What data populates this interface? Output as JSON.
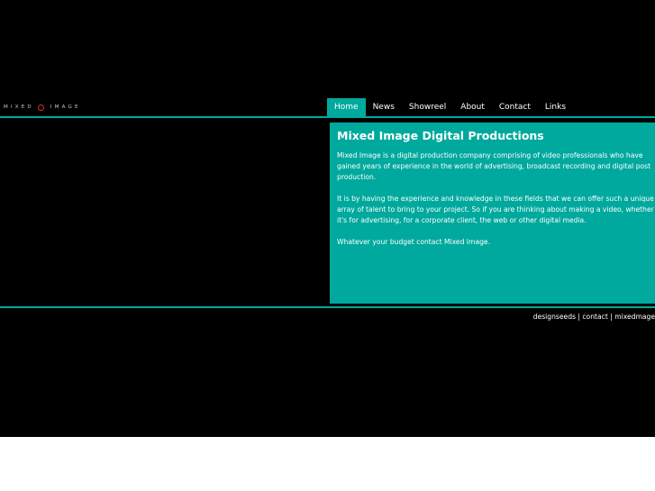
{
  "logo": {
    "left_text": "MIXED",
    "right_text": "IMAGE"
  },
  "nav": {
    "items": [
      {
        "label": "Home",
        "active": true
      },
      {
        "label": "News"
      },
      {
        "label": "Showreel"
      },
      {
        "label": "About"
      },
      {
        "label": "Contact"
      },
      {
        "label": "Links"
      }
    ]
  },
  "content": {
    "title": "Mixed Image Digital Productions",
    "paragraphs": [
      "Mixed Image is a digital production company comprising of video professionals who have gained years of experience in the world of advertising, broadcast recording and digital post production.",
      "It is by having the experience and knowledge in these fields that we can offer such a unique array of talent to bring to your project. So if you are thinking about making a video, whether it's for advertising, for a corporate client, the web or other digital media.",
      "Whatever your budget contact Mixed Image."
    ]
  },
  "footer": {
    "links": [
      "designseeds",
      "contact",
      "mixedmage"
    ],
    "separator": " | "
  },
  "colors": {
    "accent": "#00a99d",
    "background": "#000000",
    "logo_ring": "#d03030"
  }
}
